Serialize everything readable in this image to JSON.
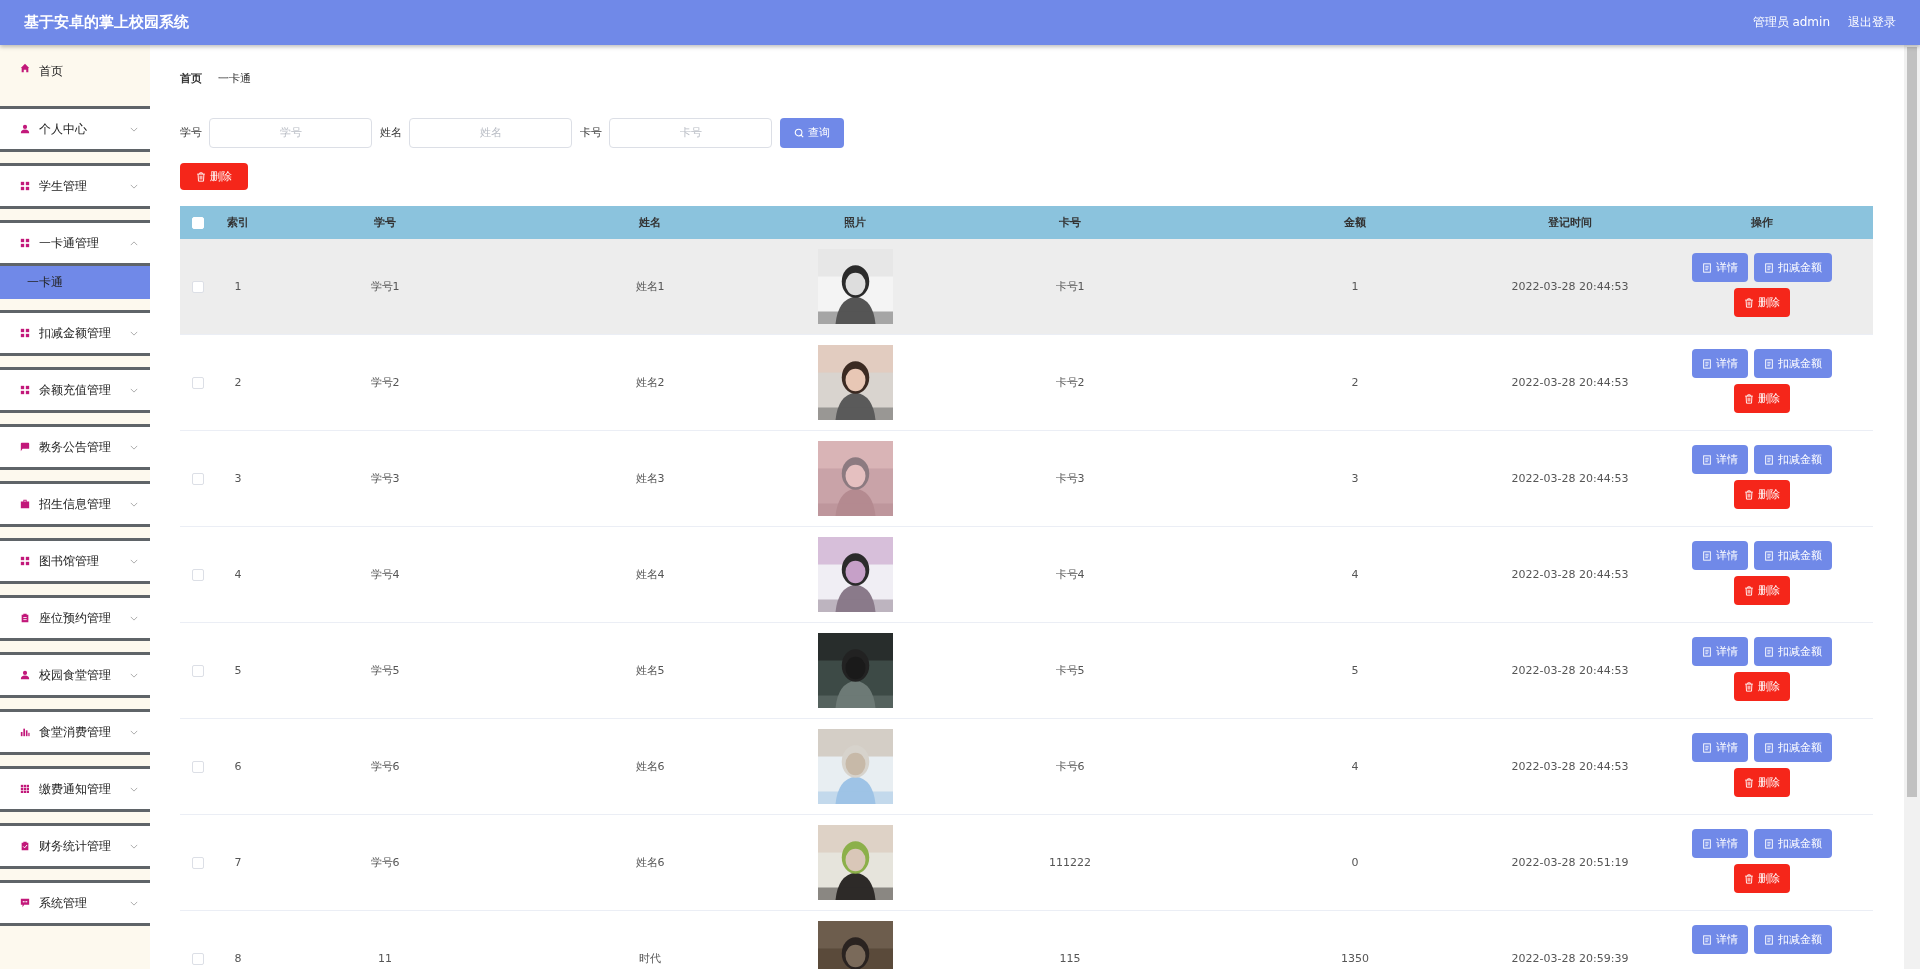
{
  "header": {
    "title": "基于安卓的掌上校园系统",
    "user": "管理员 admin",
    "logout": "退出登录"
  },
  "sidebar": {
    "items": [
      {
        "label": "首页",
        "expandable": false
      },
      {
        "label": "个人中心",
        "expandable": true,
        "expanded": false
      },
      {
        "label": "学生管理",
        "expandable": true,
        "expanded": false
      },
      {
        "label": "一卡通管理",
        "expandable": true,
        "expanded": true,
        "children": [
          {
            "label": "一卡通",
            "selected": true
          }
        ]
      },
      {
        "label": "扣减金额管理",
        "expandable": true,
        "expanded": false
      },
      {
        "label": "余额充值管理",
        "expandable": true,
        "expanded": false
      },
      {
        "label": "教务公告管理",
        "expandable": true,
        "expanded": false
      },
      {
        "label": "招生信息管理",
        "expandable": true,
        "expanded": false
      },
      {
        "label": "图书馆管理",
        "expandable": true,
        "expanded": false
      },
      {
        "label": "座位预约管理",
        "expandable": true,
        "expanded": false
      },
      {
        "label": "校园食堂管理",
        "expandable": true,
        "expanded": false
      },
      {
        "label": "食堂消费管理",
        "expandable": true,
        "expanded": false
      },
      {
        "label": "缴费通知管理",
        "expandable": true,
        "expanded": false
      },
      {
        "label": "财务统计管理",
        "expandable": true,
        "expanded": false
      },
      {
        "label": "系统管理",
        "expandable": true,
        "expanded": false
      }
    ]
  },
  "breadcrumb": [
    "首页",
    "一卡通"
  ],
  "search": {
    "fields": [
      {
        "label": "学号",
        "placeholder": "学号"
      },
      {
        "label": "姓名",
        "placeholder": "姓名"
      },
      {
        "label": "卡号",
        "placeholder": "卡号"
      }
    ],
    "button": "查询"
  },
  "delete_button": "删除",
  "table": {
    "select_all_checked": false,
    "columns": [
      "索引",
      "学号",
      "姓名",
      "照片",
      "卡号",
      "金额",
      "登记时间",
      "操作"
    ],
    "rows": [
      {
        "index": "1",
        "student_no": "学号1",
        "name": "姓名1",
        "photo": {
          "kind": "picture"
        },
        "card_no": "卡号1",
        "amount": "1",
        "time": "2022-03-28 20:44:53",
        "checked": false,
        "hovered": true,
        "actions": [
          {
            "kind": "detail",
            "label": "详情"
          },
          {
            "kind": "deduct",
            "label": "扣减金额"
          },
          {
            "kind": "delete",
            "label": "删除"
          }
        ]
      },
      {
        "index": "2",
        "student_no": "学号2",
        "name": "姓名2",
        "photo": {
          "kind": "picture"
        },
        "card_no": "卡号2",
        "amount": "2",
        "time": "2022-03-28 20:44:53",
        "checked": false,
        "hovered": false,
        "actions": [
          {
            "kind": "detail",
            "label": "详情"
          },
          {
            "kind": "deduct",
            "label": "扣减金额"
          },
          {
            "kind": "delete",
            "label": "删除"
          }
        ]
      },
      {
        "index": "3",
        "student_no": "学号3",
        "name": "姓名3",
        "photo": {
          "kind": "picture"
        },
        "card_no": "卡号3",
        "amount": "3",
        "time": "2022-03-28 20:44:53",
        "checked": false,
        "hovered": false,
        "actions": [
          {
            "kind": "detail",
            "label": "详情"
          },
          {
            "kind": "deduct",
            "label": "扣减金额"
          },
          {
            "kind": "delete",
            "label": "删除"
          }
        ]
      },
      {
        "index": "4",
        "student_no": "学号4",
        "name": "姓名4",
        "photo": {
          "kind": "picture"
        },
        "card_no": "卡号4",
        "amount": "4",
        "time": "2022-03-28 20:44:53",
        "checked": false,
        "hovered": false,
        "actions": [
          {
            "kind": "detail",
            "label": "详情"
          },
          {
            "kind": "deduct",
            "label": "扣减金额"
          },
          {
            "kind": "delete",
            "label": "删除"
          }
        ]
      },
      {
        "index": "5",
        "student_no": "学号5",
        "name": "姓名5",
        "photo": {
          "kind": "picture"
        },
        "card_no": "卡号5",
        "amount": "5",
        "time": "2022-03-28 20:44:53",
        "checked": false,
        "hovered": false,
        "actions": [
          {
            "kind": "detail",
            "label": "详情"
          },
          {
            "kind": "deduct",
            "label": "扣减金额"
          },
          {
            "kind": "delete",
            "label": "删除"
          }
        ]
      },
      {
        "index": "6",
        "student_no": "学号6",
        "name": "姓名6",
        "photo": {
          "kind": "picture"
        },
        "card_no": "卡号6",
        "amount": "4",
        "time": "2022-03-28 20:44:53",
        "checked": false,
        "hovered": false,
        "actions": [
          {
            "kind": "detail",
            "label": "详情"
          },
          {
            "kind": "deduct",
            "label": "扣减金额"
          },
          {
            "kind": "delete",
            "label": "删除"
          }
        ]
      },
      {
        "index": "7",
        "student_no": "学号6",
        "name": "姓名6",
        "photo": {
          "kind": "picture"
        },
        "card_no": "111222",
        "amount": "0",
        "time": "2022-03-28 20:51:19",
        "checked": false,
        "hovered": false,
        "actions": [
          {
            "kind": "detail",
            "label": "详情"
          },
          {
            "kind": "deduct",
            "label": "扣减金额"
          },
          {
            "kind": "delete",
            "label": "删除"
          }
        ]
      },
      {
        "index": "8",
        "student_no": "11",
        "name": "时代",
        "photo": {
          "kind": "picture"
        },
        "card_no": "115",
        "amount": "1350",
        "time": "2022-03-28 20:59:39",
        "checked": false,
        "hovered": false,
        "actions": [
          {
            "kind": "detail",
            "label": "详情"
          },
          {
            "kind": "deduct",
            "label": "扣减金额"
          }
        ]
      }
    ]
  }
}
